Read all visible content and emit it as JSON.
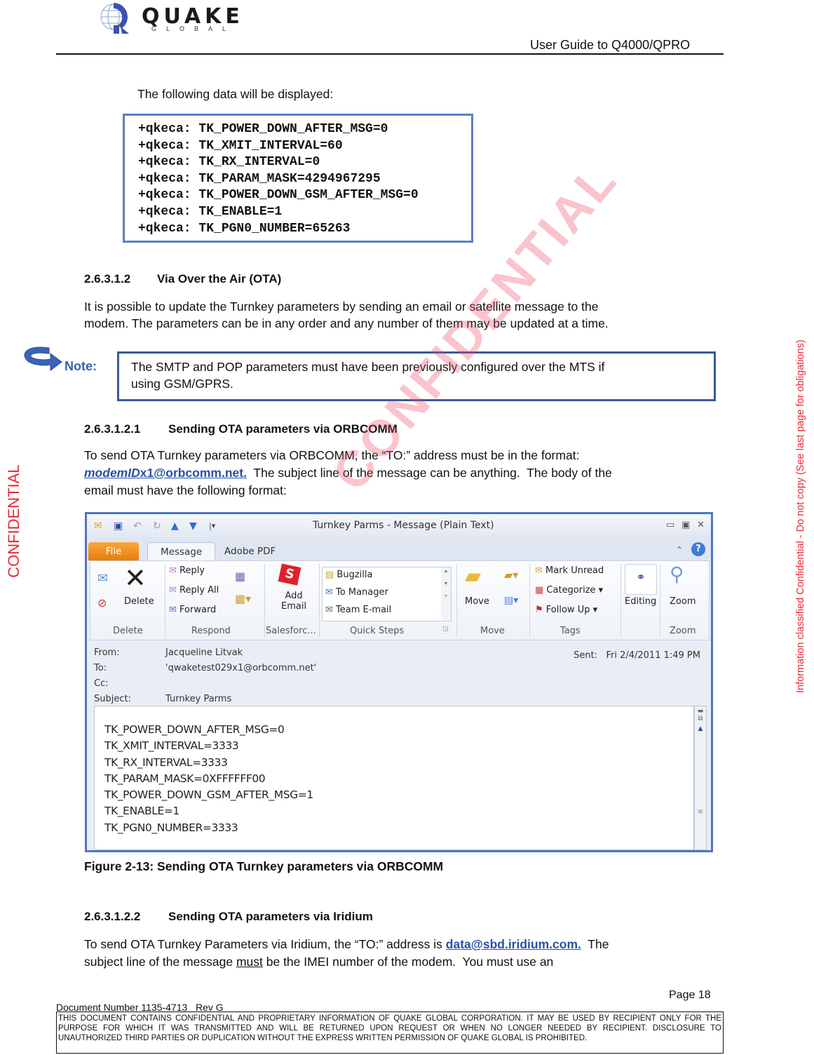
{
  "header": {
    "logo_word": "QUAKE",
    "logo_sub": "GLOBAL",
    "doc_title": "User Guide to Q4000/QPRO"
  },
  "intro": "The following data will be displayed:",
  "code_lines": [
    "+qkeca: TK_POWER_DOWN_AFTER_MSG=0",
    "+qkeca: TK_XMIT_INTERVAL=60",
    "+qkeca: TK_RX_INTERVAL=0",
    "+qkeca: TK_PARAM_MASK=4294967295",
    "+qkeca: TK_POWER_DOWN_GSM_AFTER_MSG=0",
    "+qkeca: TK_ENABLE=1",
    "+qkeca: TK_PGN0_NUMBER=65263"
  ],
  "section_ota": {
    "number": "2.6.3.1.2",
    "title": "Via Over the Air (OTA)",
    "para_line1": "It is possible to update the Turnkey parameters by sending an email or satellite message to the",
    "para_line2": "modem. The parameters can be in any order and any number of them may be updated at a time."
  },
  "note": {
    "label": "Note:",
    "line1": "The SMTP and POP parameters must have been previously configured over the MTS if",
    "line2": "using GSM/GPRS."
  },
  "section_orbcomm": {
    "number": "2.6.3.1.2.1",
    "title": "Sending OTA parameters via ORBCOMM",
    "line1": "To send OTA Turnkey parameters via ORBCOMM, the “TO:” address must be in the format:",
    "link_italic": "modemID",
    "link_rest": "x1@orbcomm.net.",
    "line2_rest": "  The subject line of the message can be anything.  The body of the",
    "line3": "email must have the following format:"
  },
  "outlook": {
    "window_title": "Turnkey Parms  -  Message (Plain Text)",
    "tabs": [
      "File",
      "Message",
      "Adobe PDF"
    ],
    "ribbon": {
      "delete_label": "Delete",
      "reply": "Reply",
      "reply_all": "Reply All",
      "forward": "Forward",
      "add_email_1": "Add",
      "add_email_2": "Email",
      "quick_steps": [
        "Bugzilla",
        "To Manager",
        "Team E-mail"
      ],
      "move": "Move",
      "mark_unread": "Mark Unread",
      "categorize": "Categorize",
      "follow_up": "Follow Up",
      "editing": "Editing",
      "zoom": "Zoom",
      "groups": [
        "Delete",
        "Respond",
        "Salesforc...",
        "Quick Steps",
        "Move",
        "Tags",
        "Zoom"
      ]
    },
    "headers": {
      "from_label": "From:",
      "from": "Jacqueline Litvak",
      "to_label": "To:",
      "to": "'qwaketest029x1@orbcomm.net'",
      "cc_label": "Cc:",
      "cc": "",
      "subject_label": "Subject:",
      "subject": "Turnkey Parms",
      "sent_label": "Sent:",
      "sent": "Fri 2/4/2011 1:49 PM"
    },
    "body_lines": [
      "TK_POWER_DOWN_AFTER_MSG=0",
      "TK_XMIT_INTERVAL=3333",
      "TK_RX_INTERVAL=3333",
      "TK_PARAM_MASK=0XFFFFFF00",
      "TK_POWER_DOWN_GSM_AFTER_MSG=1",
      "TK_ENABLE=1",
      "TK_PGN0_NUMBER=3333"
    ]
  },
  "figure_caption": "Figure 2-13:  Sending OTA Turnkey parameters via ORBCOMM",
  "section_iridium": {
    "number": "2.6.3.1.2.2",
    "title": "Sending OTA parameters via Iridium",
    "line1_pre": "To send OTA Turnkey Parameters via Iridium, the “TO:” address is ",
    "link": "data@sbd.iridium.com.",
    "line1_post": "  The",
    "line2_pre": "subject line of the message ",
    "line2_under": "must",
    "line2_post": " be the IMEI number of the modem.  You must use an"
  },
  "footer": {
    "doc_number": "Document Number 1135-4713   Rev G",
    "page": "Page 18",
    "disclaimer": "THIS DOCUMENT CONTAINS CONFIDENTIAL AND PROPRIETARY INFORMATION OF QUAKE GLOBAL CORPORATION.  IT MAY BE USED BY RECIPIENT ONLY FOR THE PURPOSE FOR WHICH IT WAS TRANSMITTED AND WILL BE RETURNED UPON REQUEST OR WHEN NO LONGER NEEDED BY RECIPIENT.  DISCLOSURE TO UNAUTHORIZED THIRD PARTIES OR DUPLICATION WITHOUT THE EXPRESS WRITTEN PERMISSION OF QUAKE GLOBAL IS PROHIBITED."
  },
  "watermarks": {
    "left": "CONFIDENTIAL",
    "right": "Information classified Confidential - Do not copy (See last page for obligations)",
    "diagonal": "CONFIDENTIAL"
  },
  "colors": {
    "accent_blue": "#3c5a98",
    "link_blue": "#2a4fa8",
    "watermark_red": "#e8283a"
  }
}
